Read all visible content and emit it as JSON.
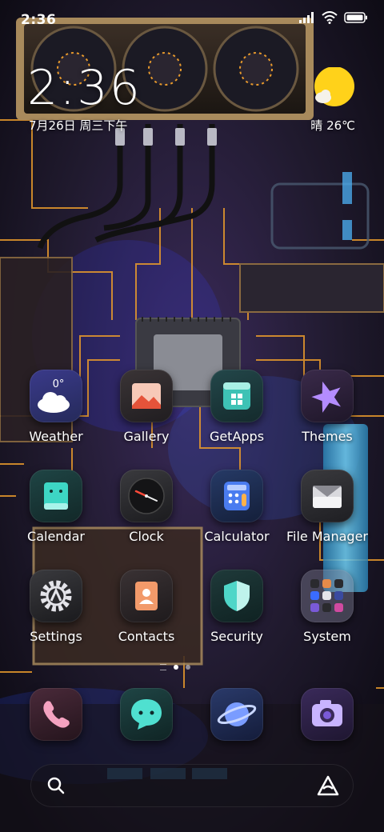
{
  "status_bar": {
    "time": "2:36",
    "icons": [
      "signal-icon",
      "wifi-icon",
      "battery-icon"
    ]
  },
  "clock_widget": {
    "time": "2:36",
    "date": "7月26日 周三下午",
    "weather": "晴 26℃"
  },
  "apps": [
    {
      "label": "Weather",
      "icon": "weather-icon",
      "badge": "0°"
    },
    {
      "label": "Gallery",
      "icon": "gallery-icon"
    },
    {
      "label": "GetApps",
      "icon": "getapps-icon"
    },
    {
      "label": "Themes",
      "icon": "themes-icon"
    },
    {
      "label": "Calendar",
      "icon": "calendar-icon"
    },
    {
      "label": "Clock",
      "icon": "clock-icon"
    },
    {
      "label": "Calculator",
      "icon": "calculator-icon"
    },
    {
      "label": "File Manager",
      "icon": "file-manager-icon"
    },
    {
      "label": "Settings",
      "icon": "settings-icon"
    },
    {
      "label": "Contacts",
      "icon": "contacts-icon"
    },
    {
      "label": "Security",
      "icon": "security-icon"
    },
    {
      "label": "System",
      "icon": "system-folder-icon"
    }
  ],
  "page_indicator": {
    "pages": 2,
    "active": 1
  },
  "dock": [
    {
      "icon": "phone-icon"
    },
    {
      "icon": "messages-icon"
    },
    {
      "icon": "browser-icon"
    },
    {
      "icon": "camera-icon"
    }
  ],
  "colors": {
    "circuit_trace": "#e89a2c",
    "accent_blue": "#3a6cff",
    "sun": "#ffd21a"
  }
}
